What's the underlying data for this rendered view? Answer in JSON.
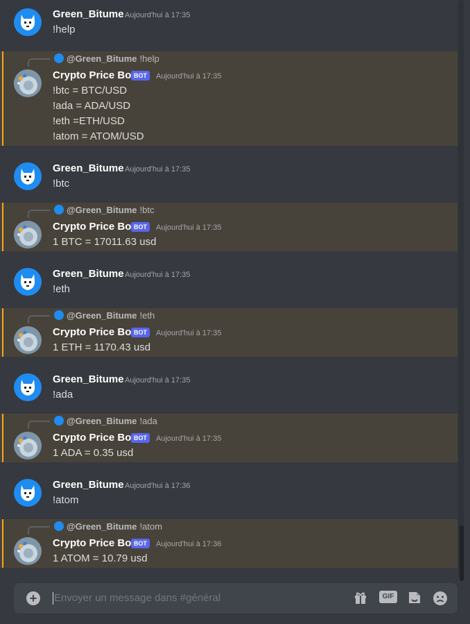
{
  "messages": [
    {
      "type": "user",
      "username": "Green_Bitume",
      "timestamp": "Aujourd'hui à 17:35",
      "lines": [
        "!help"
      ]
    },
    {
      "type": "bot",
      "reply_user": "@Green_Bitume",
      "reply_content": "!help",
      "username": "Crypto Price Bot",
      "badge": "BOT",
      "timestamp": "Aujourd'hui à 17:35",
      "lines": [
        "!btc = BTC/USD",
        "!ada = ADA/USD",
        "!eth =ETH/USD",
        "!atom = ATOM/USD"
      ]
    },
    {
      "type": "user",
      "username": "Green_Bitume",
      "timestamp": "Aujourd'hui à 17:35",
      "lines": [
        "!btc"
      ]
    },
    {
      "type": "bot",
      "reply_user": "@Green_Bitume",
      "reply_content": "!btc",
      "username": "Crypto Price Bot",
      "badge": "BOT",
      "timestamp": "Aujourd'hui à 17:35",
      "lines": [
        "1 BTC = 17011.63 usd"
      ]
    },
    {
      "type": "user",
      "username": "Green_Bitume",
      "timestamp": "Aujourd'hui à 17:35",
      "lines": [
        "!eth"
      ]
    },
    {
      "type": "bot",
      "reply_user": "@Green_Bitume",
      "reply_content": "!eth",
      "username": "Crypto Price Bot",
      "badge": "BOT",
      "timestamp": "Aujourd'hui à 17:35",
      "lines": [
        "1 ETH = 1170.43 usd"
      ]
    },
    {
      "type": "user",
      "username": "Green_Bitume",
      "timestamp": "Aujourd'hui à 17:35",
      "lines": [
        "!ada"
      ]
    },
    {
      "type": "bot",
      "reply_user": "@Green_Bitume",
      "reply_content": "!ada",
      "username": "Crypto Price Bot",
      "badge": "BOT",
      "timestamp": "Aujourd'hui à 17:35",
      "lines": [
        "1 ADA = 0.35 usd"
      ]
    },
    {
      "type": "user",
      "username": "Green_Bitume",
      "timestamp": "Aujourd'hui à 17:36",
      "lines": [
        "!atom"
      ]
    },
    {
      "type": "bot",
      "reply_user": "@Green_Bitume",
      "reply_content": "!atom",
      "username": "Crypto Price Bot",
      "badge": "BOT",
      "timestamp": "Aujourd'hui à 17:36",
      "lines": [
        "1 ATOM = 10.79 usd"
      ]
    }
  ],
  "composer": {
    "placeholder": "Envoyer un message dans #général",
    "gif_label": "GIF",
    "icons": [
      "add-icon",
      "gift-icon",
      "gif-icon",
      "sticker-icon",
      "emoji-icon"
    ]
  },
  "colors": {
    "background": "#36393f",
    "bot_highlight": "#48433a",
    "mention_bar": "#faa61a",
    "badge": "#5865f2",
    "user_avatar": "#1e8cf0"
  }
}
